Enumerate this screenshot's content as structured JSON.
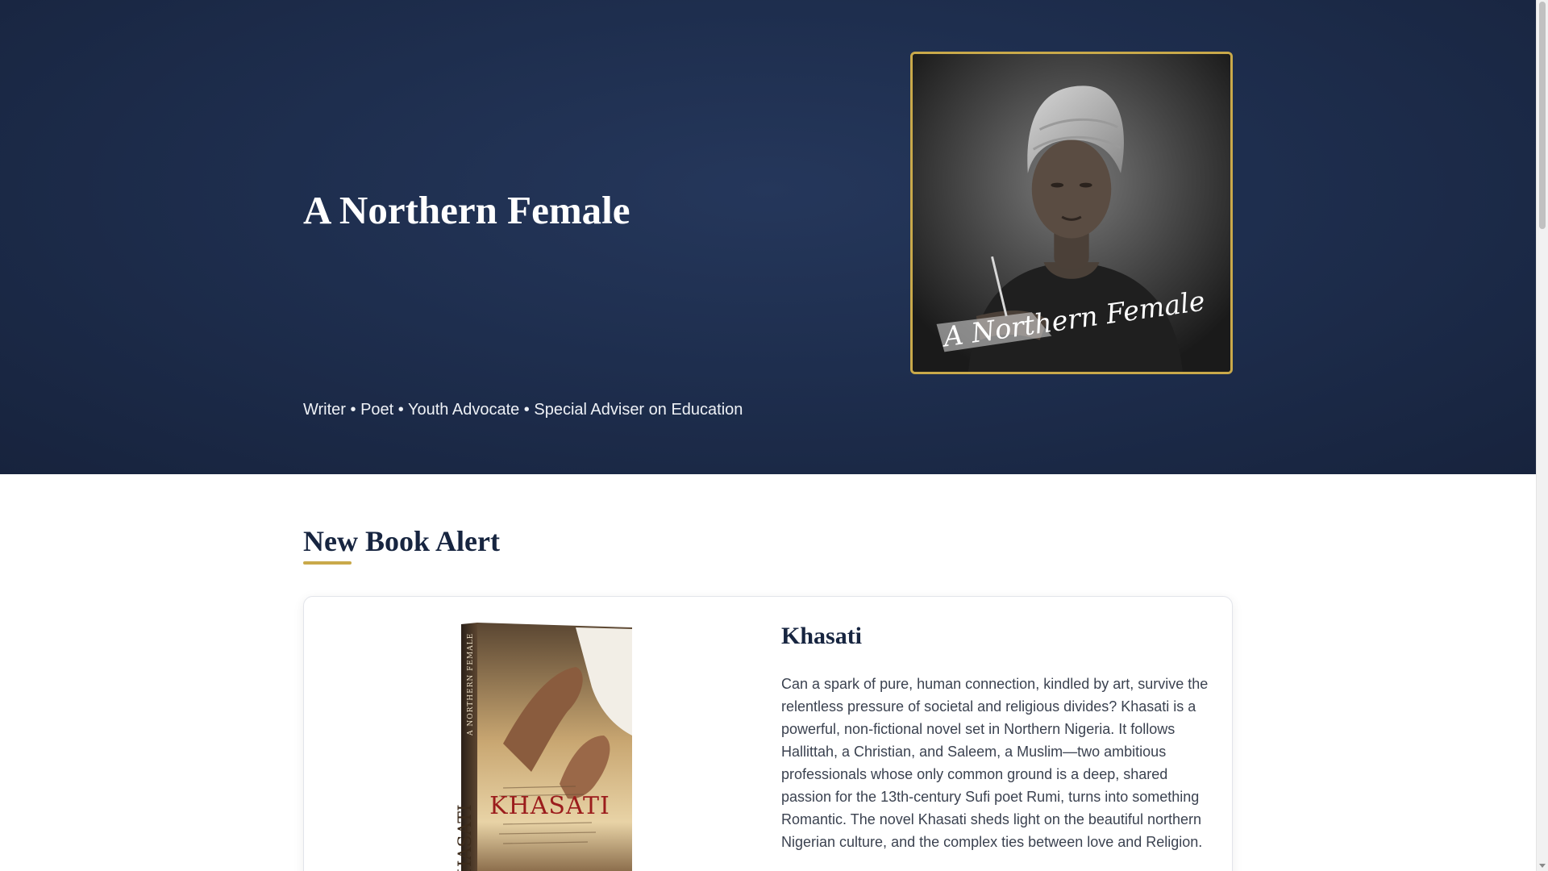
{
  "hero": {
    "title": "A Northern Female",
    "tagline": "Writer • Poet • Youth Advocate • Special Adviser on Education",
    "portrait_signature": "A Northern Female"
  },
  "new_book": {
    "heading": "New Book Alert",
    "book": {
      "title": "Khasati",
      "cover_title": "KHASATI",
      "cover_spine_title": "KHASATI",
      "cover_author": "A NORTHERN FEMALE",
      "description": "Can a spark of pure, human connection, kindled by art, survive the relentless pressure of societal and religious divides? Khasati is a powerful, non-fictional novel set in Northern Nigeria. It follows Hallittah, a Christian, and Saleem, a Muslim—two ambitious professionals whose only common ground is a deep, shared passion for the 13th-century Sufi poet Rumi, turns into something Romantic. The novel Khasati sheds light on the beautiful northern Nigerian culture, and the complex ties between love and Religion."
    }
  },
  "colors": {
    "hero_bg": "#1e2e4e",
    "accent_gold": "#c9a94a",
    "heading_navy": "#172540",
    "body_text": "#3b4250"
  }
}
